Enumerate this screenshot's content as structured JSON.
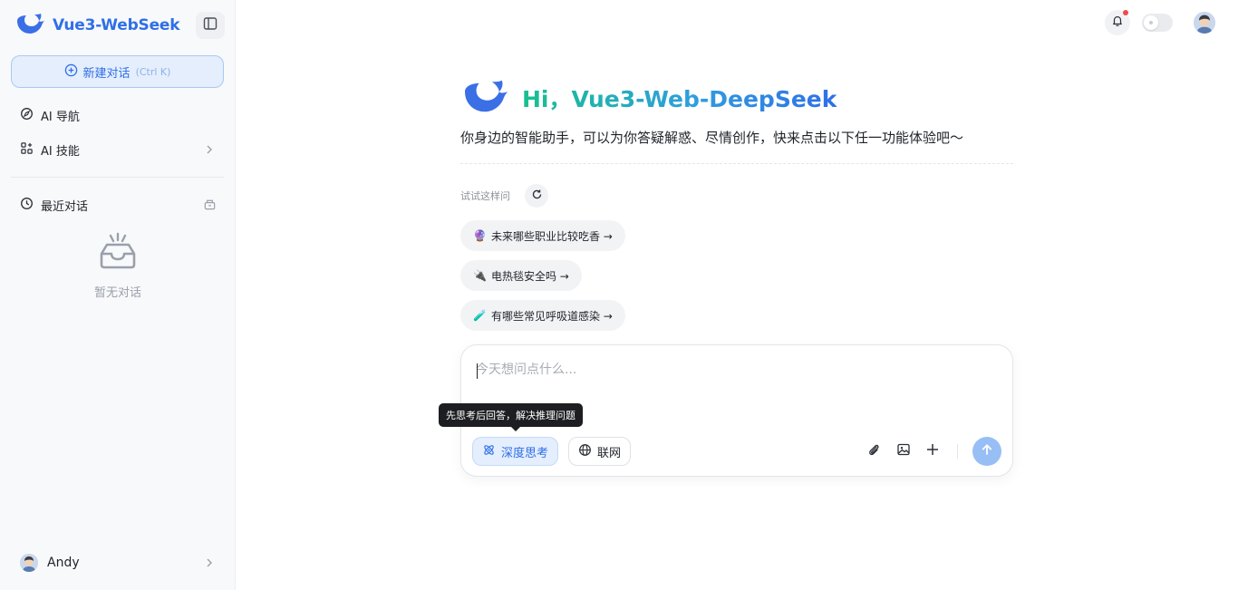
{
  "sidebar": {
    "brand": "Vue3-WebSeek",
    "new_chat": {
      "label": "新建对话",
      "shortcut": "(Ctrl K)"
    },
    "nav": [
      {
        "label": "AI 导航",
        "icon": "compass-icon"
      },
      {
        "label": "AI 技能",
        "icon": "apps-icon"
      }
    ],
    "recent": {
      "label": "最近对话",
      "empty_text": "暂无对话"
    },
    "user": {
      "name": "Andy"
    }
  },
  "header": {
    "notification_badge": true
  },
  "main": {
    "title": "Hi，Vue3-Web-DeepSeek",
    "subtitle": "你身边的智能助手，可以为你答疑解惑、尽情创作，快来点击以下任一功能体验吧～",
    "try_label": "试试这样问",
    "suggestions": [
      {
        "emoji": "🔮",
        "text": "未来哪些职业比较吃香 →"
      },
      {
        "emoji": "🔌",
        "text": "电热毯安全吗 →"
      },
      {
        "emoji": "🧪",
        "text": "有哪些常见呼吸道感染 →"
      }
    ]
  },
  "composer": {
    "placeholder": "今天想问点什么...",
    "value": "",
    "tooltip": "先思考后回答，解决推理问题",
    "deep_think_label": "深度思考",
    "web_label": "联网"
  },
  "colors": {
    "accent": "#2f6fe8",
    "gradient_start": "#18c08f",
    "send_disabled": "#97bff5"
  }
}
